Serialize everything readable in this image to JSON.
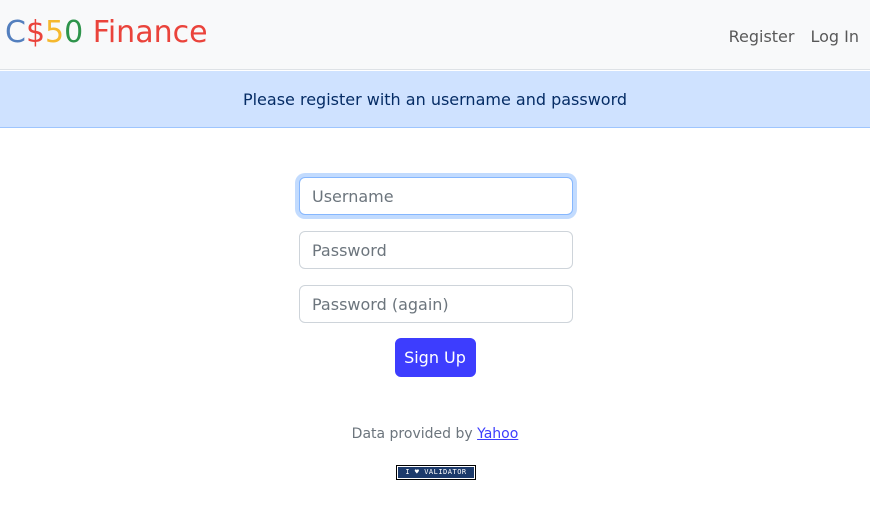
{
  "brand": {
    "c": "C",
    "dollar": "$",
    "five": "5",
    "zero": "0",
    "finance": " Finance"
  },
  "nav": {
    "register": "Register",
    "login": "Log In"
  },
  "alert": {
    "message": "Please register with an username and password"
  },
  "form": {
    "username_placeholder": "Username",
    "password_placeholder": "Password",
    "confirmation_placeholder": "Password (again)",
    "submit_label": "Sign Up"
  },
  "footer": {
    "prefix": "Data provided by ",
    "link_label": "Yahoo"
  },
  "badge": {
    "label": "I ♥ VALIDATOR"
  },
  "colors": {
    "brand_blue": "#537fbe",
    "brand_red": "#ea433b",
    "brand_yellow": "#f5b82e",
    "brand_green": "#2e944b",
    "primary_button": "#3d3dfe",
    "alert_bg": "#cfe2ff"
  }
}
